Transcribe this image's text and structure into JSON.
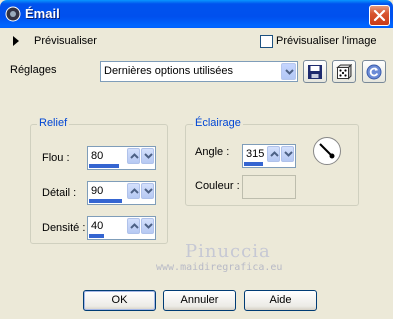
{
  "window": {
    "title": "Émail"
  },
  "preview": {
    "label": "Prévisualiser",
    "checkbox_label": "Prévisualiser l'image",
    "checked": false
  },
  "settings": {
    "label": "Réglages",
    "preset_value": "Dernières options utilisées"
  },
  "relief": {
    "title": "Relief",
    "fields": [
      {
        "label": "Flou :",
        "value": "80",
        "fill_fraction": 0.8
      },
      {
        "label": "Détail :",
        "value": "90",
        "fill_fraction": 0.9
      },
      {
        "label": "Densité :",
        "value": "40",
        "fill_fraction": 0.4
      }
    ]
  },
  "lighting": {
    "title": "Éclairage",
    "angle_label": "Angle :",
    "angle_value": "315",
    "angle_fill_fraction": 0.875,
    "color_label": "Couleur :"
  },
  "watermark": {
    "name": "Pinuccia",
    "url": "www.maidiregrafica.eu"
  },
  "buttons": {
    "ok": "OK",
    "cancel": "Annuler",
    "help": "Aide"
  }
}
